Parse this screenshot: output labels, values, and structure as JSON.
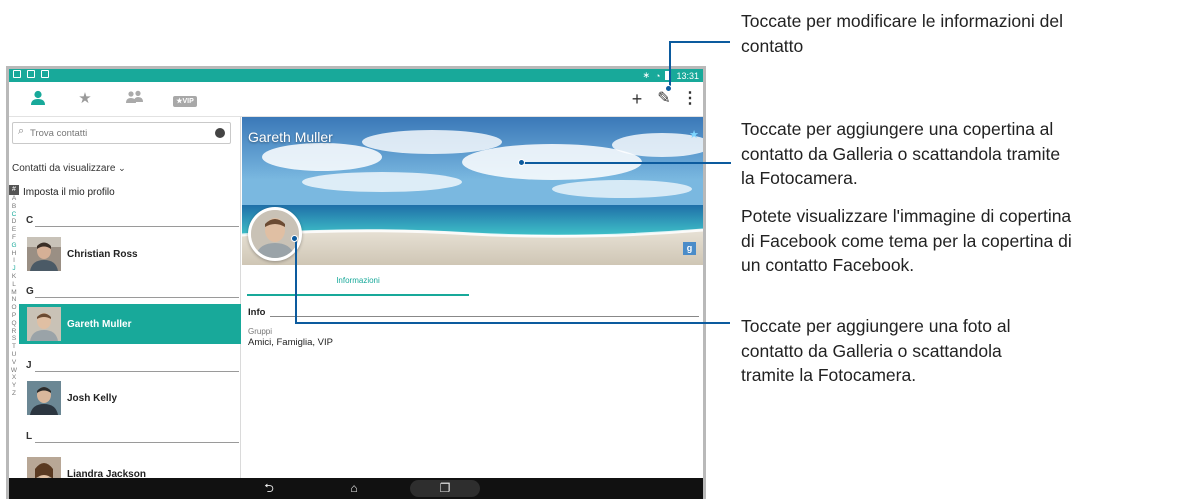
{
  "status_bar": {
    "time": "13:31"
  },
  "action_bar": {
    "tabs": [
      {
        "name": "contacts",
        "icon": "person-icon"
      },
      {
        "name": "favorites",
        "icon": "star-icon"
      },
      {
        "name": "groups",
        "icon": "group-icon"
      },
      {
        "name": "vip",
        "icon": "vip-icon",
        "label": "VIP"
      }
    ],
    "actions": [
      {
        "name": "add",
        "icon": "plus-icon",
        "glyph": "+"
      },
      {
        "name": "edit",
        "icon": "pencil-icon",
        "glyph": "✎"
      },
      {
        "name": "more",
        "icon": "overflow-menu-icon",
        "glyph": "⋮"
      }
    ]
  },
  "contacts_panel": {
    "search_placeholder": "Trova contatti",
    "filter_label": "Contatti da visualizzare",
    "index_letters": [
      "#",
      "A",
      "B",
      "C",
      "D",
      "E",
      "F",
      "G",
      "H",
      "I",
      "J",
      "K",
      "L",
      "M",
      "N",
      "O",
      "P",
      "Q",
      "R",
      "S",
      "T",
      "U",
      "V",
      "W",
      "X",
      "Y",
      "Z"
    ],
    "my_profile": "Imposta il mio profilo",
    "sections": [
      {
        "letter": "C"
      },
      {
        "letter": "G"
      },
      {
        "letter": "J"
      },
      {
        "letter": "L"
      }
    ],
    "contacts": [
      {
        "name": "Christian Ross",
        "selected": false
      },
      {
        "name": "Gareth Muller",
        "selected": true
      },
      {
        "name": "Josh Kelly",
        "selected": false
      },
      {
        "name": "Liandra Jackson",
        "selected": false
      }
    ]
  },
  "detail": {
    "contact_name": "Gareth Muller",
    "tab_label": "Informazioni",
    "info_heading": "Info",
    "groups_label": "Gruppi",
    "groups_value": "Amici, Famiglia, VIP",
    "google_badge": "g"
  },
  "nav_bar": {
    "back": "⮌",
    "home": "⌂",
    "recent": "❐"
  },
  "callouts": {
    "edit_info": [
      "Toccate per modificare le informazioni del",
      "contatto"
    ],
    "add_cover": [
      "Toccate per aggiungere una copertina al",
      "contatto da Galleria o scattandola tramite",
      "la Fotocamera."
    ],
    "facebook_cover": [
      "Potete visualizzare l'immagine di copertina",
      "di Facebook come tema per la copertina di",
      "un contatto Facebook."
    ],
    "add_photo": [
      "Toccate per aggiungere una foto al",
      "contatto da Galleria o scattandola",
      "tramite la Fotocamera."
    ]
  },
  "colors": {
    "accent": "#18a99a",
    "callout_line": "#0c5b9e"
  }
}
